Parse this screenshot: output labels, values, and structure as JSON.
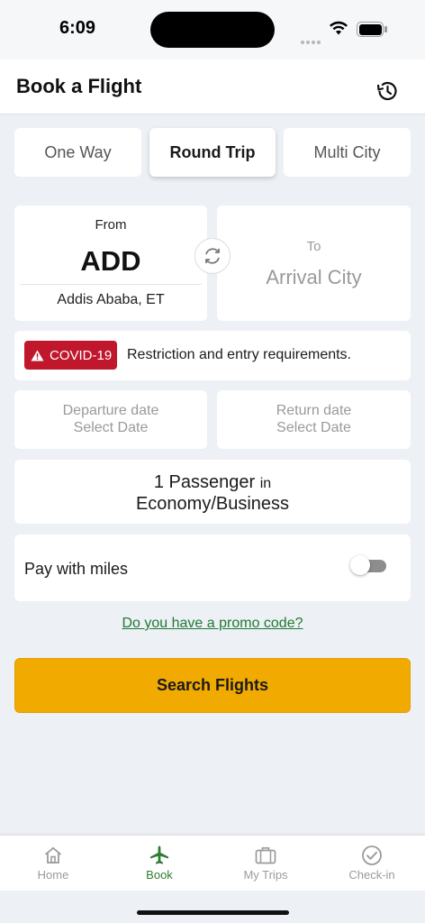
{
  "status_bar": {
    "time": "6:09"
  },
  "header": {
    "title": "Book a Flight",
    "history_icon": "history-icon"
  },
  "trip_types": [
    {
      "label": "One Way",
      "active": false
    },
    {
      "label": "Round Trip",
      "active": true
    },
    {
      "label": "Multi City",
      "active": false
    }
  ],
  "from": {
    "label": "From",
    "code": "ADD",
    "city": "Addis Ababa, ET"
  },
  "to": {
    "label": "To",
    "placeholder": "Arrival City"
  },
  "covid": {
    "badge": "COVID-19",
    "text": "Restriction and entry requirements.",
    "badge_color": "#c0172c"
  },
  "departure": {
    "label": "Departure date",
    "placeholder": "Select Date"
  },
  "return": {
    "label": "Return date",
    "placeholder": "Select Date"
  },
  "passengers": {
    "count_text": "1 Passenger",
    "connector": "in",
    "cabin": "Economy/Business"
  },
  "miles": {
    "label": "Pay with miles",
    "enabled": false
  },
  "promo": {
    "text": "Do you have a promo code?",
    "color": "#1f7a36"
  },
  "search": {
    "label": "Search Flights",
    "color": "#f1aa00"
  },
  "tabs": [
    {
      "label": "Home",
      "icon": "home-icon",
      "active": false
    },
    {
      "label": "Book",
      "icon": "airplane-icon",
      "active": true
    },
    {
      "label": "My Trips",
      "icon": "suitcase-icon",
      "active": false
    },
    {
      "label": "Check-in",
      "icon": "check-circle-icon",
      "active": false
    }
  ],
  "accent_color": "#2f7d32"
}
